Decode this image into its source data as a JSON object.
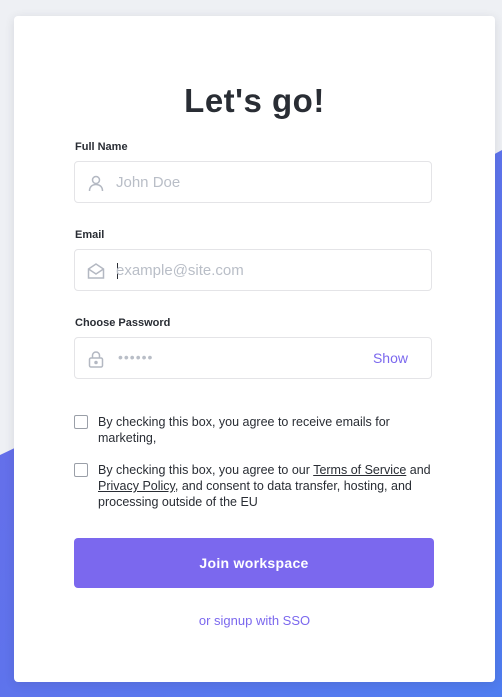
{
  "title": "Let's go!",
  "full_name": {
    "label": "Full Name",
    "placeholder": "John Doe"
  },
  "email": {
    "label": "Email",
    "placeholder": "example@site.com"
  },
  "password": {
    "label": "Choose Password",
    "masked": "••••••",
    "show_label": "Show"
  },
  "consent_marketing": {
    "text": "By checking this box, you agree to receive emails for marketing,"
  },
  "consent_terms": {
    "prefix": "By checking this box, you agree to our ",
    "terms_link": "Terms of Service",
    "and": " and ",
    "privacy_link": "Privacy Policy",
    "suffix": ", and consent to data transfer, hosting, and processing outside of the EU"
  },
  "join_button": "Join workspace",
  "sso_link": "or signup with SSO",
  "colors": {
    "accent": "#7b68ee",
    "text": "#292d34",
    "placeholder": "#b9bec7",
    "border": "#e4e4e7"
  },
  "icons": {
    "name_field": "user-icon",
    "email_field": "envelope-icon",
    "password_field": "lock-icon"
  }
}
